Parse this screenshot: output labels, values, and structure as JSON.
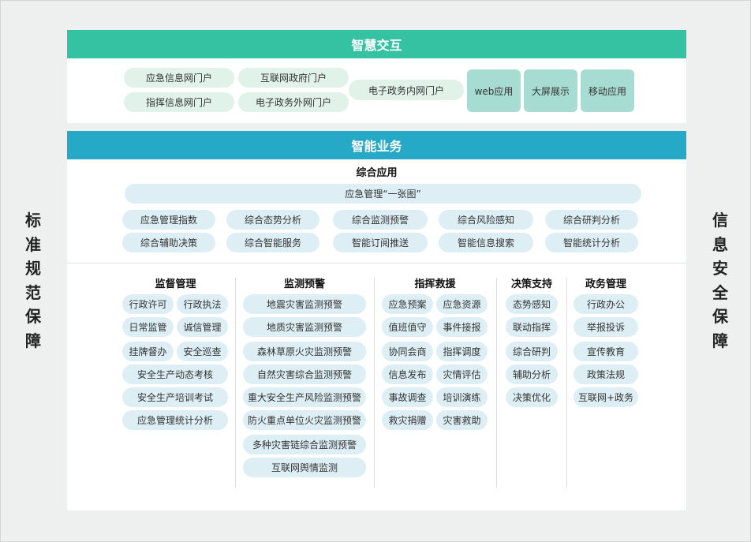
{
  "side_left": [
    "标",
    "准",
    "规",
    "范",
    "保",
    "障"
  ],
  "side_right": [
    "信",
    "息",
    "安",
    "全",
    "保",
    "障"
  ],
  "interaction": {
    "title": "智慧交互",
    "portals": [
      "应急信息网门户",
      "指挥信息网门户",
      "互联网政府门户",
      "电子政务外网门户",
      "电子政务内网门户"
    ],
    "tiles": [
      "web应用",
      "大屏展示",
      "移动应用"
    ]
  },
  "business": {
    "title": "智能业务",
    "comprehensive": {
      "title": "综合应用",
      "banner": "应急管理“一张图”",
      "items": [
        "应急管理指数",
        "综合态势分析",
        "综合监测预警",
        "综合风险感知",
        "综合研判分析",
        "综合辅助决策",
        "综合智能服务",
        "智能订阅推送",
        "智能信息搜索",
        "智能统计分析"
      ]
    },
    "supervision": {
      "title": "监督管理",
      "items": [
        "行政许可",
        "行政执法",
        "日常监管",
        "诚信管理",
        "挂牌督办",
        "安全巡查",
        "安全生产动态考核",
        "安全生产培训考试",
        "应急管理统计分析"
      ]
    },
    "monitoring": {
      "title": "监测预警",
      "items": [
        "地震灾害监测预警",
        "地质灾害监测预警",
        "森林草原火灾监测预警",
        "自然灾害综合监测预警",
        "重大安全生产风险监测预警",
        "防火重点单位火灾监测预警",
        "多种灾害链综合监测预警",
        "互联网舆情监测"
      ]
    },
    "rescue": {
      "title": "指挥救援",
      "items": [
        "应急预案",
        "应急资源",
        "值班值守",
        "事件接报",
        "协同会商",
        "指挥调度",
        "信息发布",
        "灾情评估",
        "事故调查",
        "培训演练",
        "救灾捐赠",
        "灾害救助"
      ]
    },
    "decision": {
      "title": "决策支持",
      "items": [
        "态势感知",
        "联动指挥",
        "综合研判",
        "辅助分析",
        "决策优化"
      ]
    },
    "affairs": {
      "title": "政务管理",
      "items": [
        "行政办公",
        "举报投诉",
        "宣传教育",
        "政策法规",
        "互联网+政务"
      ]
    }
  }
}
